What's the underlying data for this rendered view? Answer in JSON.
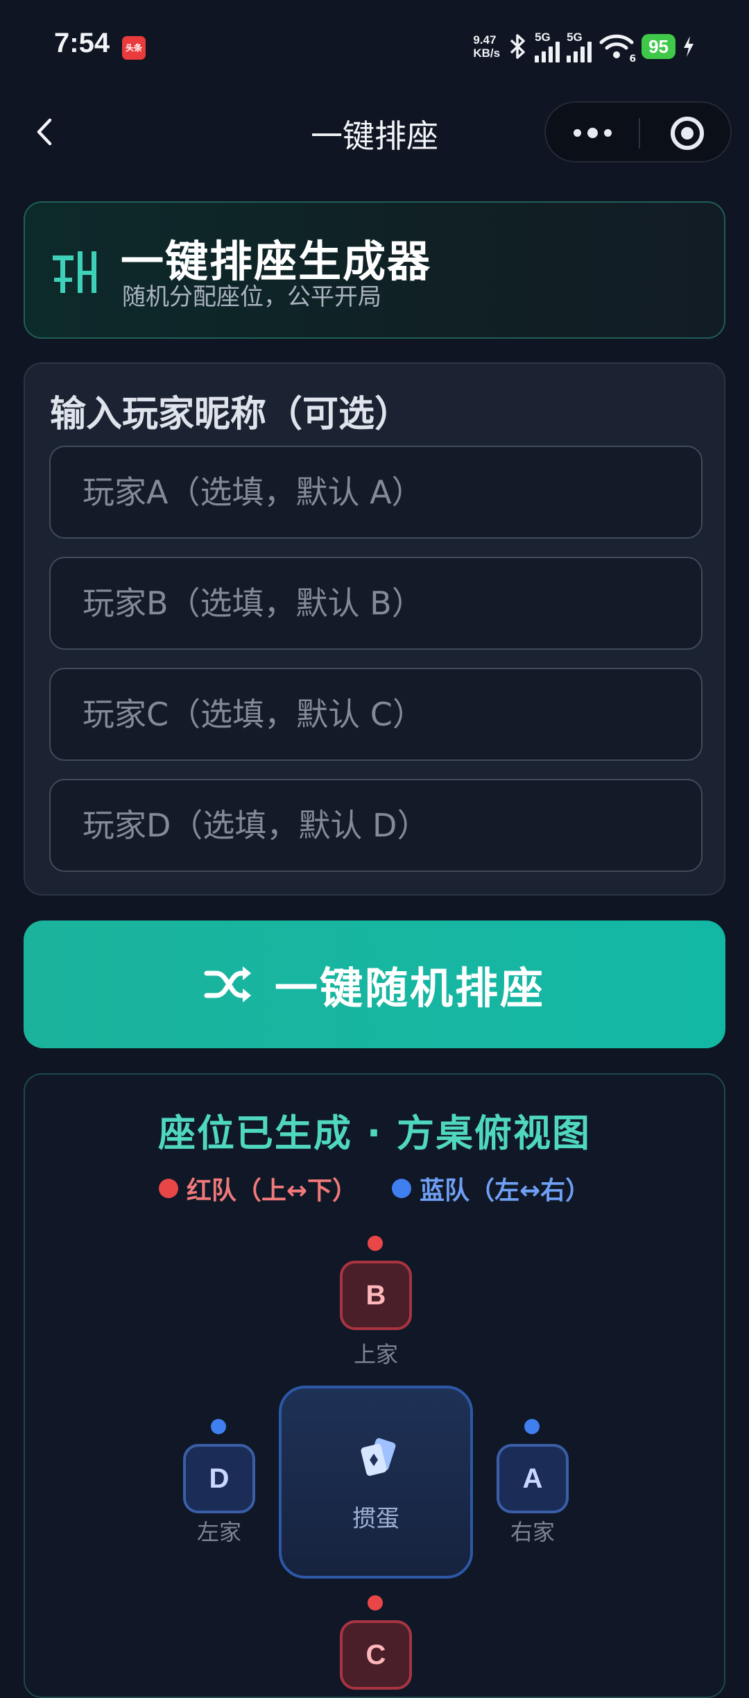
{
  "status_bar": {
    "time": "7:54",
    "app_badge": "头条",
    "net_speed_value": "9.47",
    "net_speed_unit": "KB/s",
    "signal_1": "5G",
    "signal_2": "5G",
    "wifi_badge": "6",
    "battery": "95"
  },
  "nav": {
    "title": "一键排座",
    "icons": [
      "back-icon",
      "more-icon",
      "target-icon"
    ]
  },
  "header": {
    "title": "一键排座生成器",
    "subtitle": "随机分配座位，公平开局"
  },
  "input_section": {
    "title": "输入玩家昵称（可选）",
    "fields": [
      {
        "placeholder": "玩家A（选填，默认 A）",
        "value": ""
      },
      {
        "placeholder": "玩家B（选填，默认 B）",
        "value": ""
      },
      {
        "placeholder": "玩家C（选填，默认 C）",
        "value": ""
      },
      {
        "placeholder": "玩家D（选填，默认 D）",
        "value": ""
      }
    ]
  },
  "action_button": {
    "label": "一键随机排座",
    "icon": "shuffle-icon"
  },
  "result": {
    "title": "座位已生成 · 方桌俯视图",
    "legend": [
      {
        "label": "红队（上↔下）",
        "color": "#e94747"
      },
      {
        "label": "蓝队（左↔右）",
        "color": "#3f7ff0"
      }
    ],
    "table_label": "掼蛋",
    "seats": {
      "top": {
        "letter": "B",
        "position": "上家",
        "team": "red"
      },
      "left": {
        "letter": "D",
        "position": "左家",
        "team": "blue"
      },
      "right": {
        "letter": "A",
        "position": "右家",
        "team": "blue"
      },
      "bottom": {
        "letter": "C",
        "team": "red"
      }
    }
  },
  "colors": {
    "accent": "#13b8a5",
    "red_team": "#e94747",
    "blue_team": "#3f7ff0",
    "title_teal": "#4fd8bf"
  }
}
